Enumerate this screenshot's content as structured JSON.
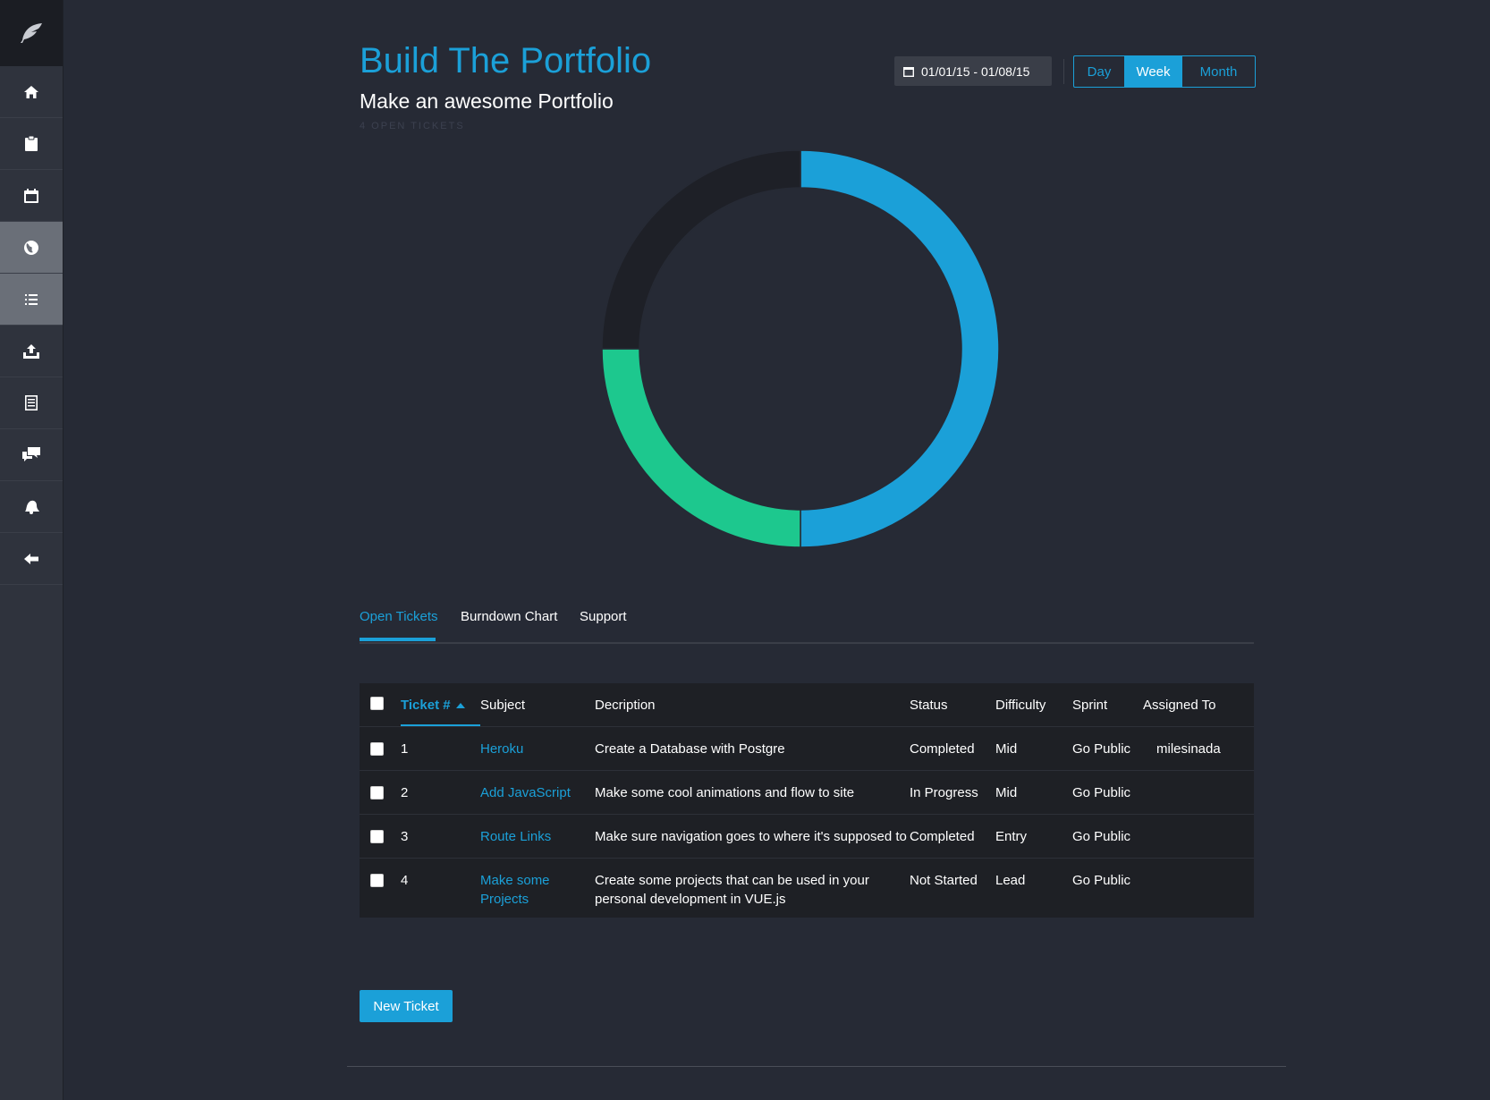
{
  "sidebar": {
    "items": [
      {
        "icon": "home-icon",
        "active": false
      },
      {
        "icon": "clipboard-icon",
        "active": false
      },
      {
        "icon": "calendar-icon",
        "active": false
      },
      {
        "icon": "globe-icon",
        "active": true
      },
      {
        "icon": "list-icon",
        "active": true
      },
      {
        "icon": "upload-icon",
        "active": false
      },
      {
        "icon": "document-icon",
        "active": false
      },
      {
        "icon": "chat-icon",
        "active": false
      },
      {
        "icon": "bell-icon",
        "active": false
      },
      {
        "icon": "back-arrow-icon",
        "active": false
      }
    ]
  },
  "header": {
    "title": "Build The Portfolio",
    "subtitle": "Make an awesome Portfolio",
    "open_count": "4 OPEN TICKETS",
    "date_range": "01/01/15 - 01/08/15",
    "view_options": [
      "Day",
      "Week",
      "Month"
    ],
    "selected_view": "Week"
  },
  "chart_data": {
    "type": "pie",
    "style": "donut",
    "values": [
      50,
      25,
      25
    ],
    "colors": [
      "#1ba0d8",
      "#1dc88e",
      "#1e2027"
    ]
  },
  "tabs": [
    "Open Tickets",
    "Burndown Chart",
    "Support"
  ],
  "table": {
    "headers": [
      "Ticket #",
      "Subject",
      "Decription",
      "Status",
      "Difficulty",
      "Sprint",
      "Assigned To"
    ],
    "rows": [
      {
        "num": "1",
        "subject": "Heroku",
        "description": "Create a Database with Postgre",
        "status": "Completed",
        "difficulty": "Mid",
        "sprint": "Go Public",
        "assigned": "milesinada"
      },
      {
        "num": "2",
        "subject": "Add JavaScript",
        "description": "Make some cool animations and flow to site",
        "status": "In Progress",
        "difficulty": "Mid",
        "sprint": "Go Public",
        "assigned": ""
      },
      {
        "num": "3",
        "subject": "Route Links",
        "description": "Make sure navigation goes to where it's supposed to",
        "status": "Completed",
        "difficulty": "Entry",
        "sprint": "Go Public",
        "assigned": ""
      },
      {
        "num": "4",
        "subject": "Make some Projects",
        "description": "Create some projects that can be used in your personal development in VUE.js",
        "status": "Not Started",
        "difficulty": "Lead",
        "sprint": "Go Public",
        "assigned": ""
      }
    ]
  },
  "new_ticket_label": "New Ticket",
  "colors": {
    "accent": "#1ba0d8",
    "green": "#1dc88e",
    "background": "#262a35",
    "sidebar": "#2f333d"
  }
}
